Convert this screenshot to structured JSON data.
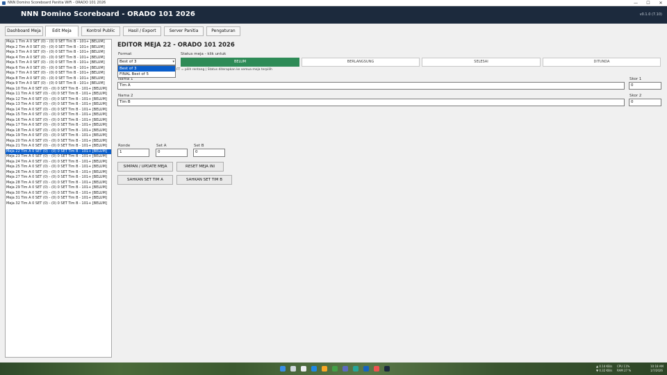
{
  "window": {
    "os_title": "NNN Domino Scoreboard Panitia WiFi - ORADO 101 2026",
    "minimize": "—",
    "maximize": "☐",
    "close": "✕"
  },
  "header": {
    "title": "NNN Domino Scoreboard - ORADO 101 2026",
    "version": "v0.1.0 (7.10)"
  },
  "tabs": [
    {
      "label": "Dashboard Meja"
    },
    {
      "label": "Edit Meja"
    },
    {
      "label": "Kontrol Public"
    },
    {
      "label": "Hasil / Export"
    },
    {
      "label": "Server Panitia"
    },
    {
      "label": "Pengaturan"
    }
  ],
  "meja_list": [
    "Meja 1   Tim A  0 SET  (0)  -  (0)  0 SET  Tim B  -  101+  [BELUM]",
    "Meja 2   Tim A  0 SET  (0)  -  (0)  0 SET  Tim B  -  101+  [BELUM]",
    "Meja 3   Tim A  0 SET  (0)  -  (0)  0 SET  Tim B  -  101+  [BELUM]",
    "Meja 4   Tim A  0 SET  (0)  -  (0)  0 SET  Tim B  -  101+  [BELUM]",
    "Meja 5   Tim A  0 SET  (0)  -  (0)  0 SET  Tim B  -  101+  [BELUM]",
    "Meja 6   Tim A  0 SET  (0)  -  (0)  0 SET  Tim B  -  101+  [BELUM]",
    "Meja 7   Tim A  0 SET  (0)  -  (0)  0 SET  Tim B  -  101+  [BELUM]",
    "Meja 8   Tim A  0 SET  (0)  -  (0)  0 SET  Tim B  -  101+  [BELUM]",
    "Meja 9   Tim A  0 SET  (0)  -  (0)  0 SET  Tim B  -  101+  [BELUM]",
    "Meja 10  Tim A  0 SET  (0)  -  (0)  0 SET  Tim B  -  101+  [BELUM]",
    "Meja 11  Tim A  0 SET  (0)  -  (0)  0 SET  Tim B  -  101+  [BELUM]",
    "Meja 12  Tim A  0 SET  (0)  -  (0)  0 SET  Tim B  -  101+  [BELUM]",
    "Meja 13  Tim A  0 SET  (0)  -  (0)  0 SET  Tim B  -  101+  [BELUM]",
    "Meja 14  Tim A  0 SET  (0)  -  (0)  0 SET  Tim B  -  101+  [BELUM]",
    "Meja 15  Tim A  0 SET  (0)  -  (0)  0 SET  Tim B  -  101+  [BELUM]",
    "Meja 16  Tim A  0 SET  (0)  -  (0)  0 SET  Tim B  -  101+  [BELUM]",
    "Meja 17  Tim A  0 SET  (0)  -  (0)  0 SET  Tim B  -  101+  [BELUM]",
    "Meja 18  Tim A  0 SET  (0)  -  (0)  0 SET  Tim B  -  101+  [BELUM]",
    "Meja 19  Tim A  0 SET  (0)  -  (0)  0 SET  Tim B  -  101+  [BELUM]",
    "Meja 20  Tim A  0 SET  (0)  -  (0)  0 SET  Tim B  -  101+  [BELUM]",
    "Meja 21  Tim A  0 SET  (0)  -  (0)  0 SET  Tim B  -  101+  [BELUM]",
    "Meja 22  Tim A  0 SET  (0)  -  (0)  0 SET  Tim B  -  101+  [BELUM]",
    "Meja 23  Tim A  0 SET  (0)  -  (0)  0 SET  Tim B  -  101+  [BELUM]",
    "Meja 24  Tim A  0 SET  (0)  -  (0)  0 SET  Tim B  -  101+  [BELUM]",
    "Meja 25  Tim A  0 SET  (0)  -  (0)  0 SET  Tim B  -  101+  [BELUM]",
    "Meja 26  Tim A  0 SET  (0)  -  (0)  0 SET  Tim B  -  101+  [BELUM]",
    "Meja 27  Tim A  0 SET  (0)  -  (0)  0 SET  Tim B  -  101+  [BELUM]",
    "Meja 28  Tim A  0 SET  (0)  -  (0)  0 SET  Tim B  -  101+  [BELUM]",
    "Meja 29  Tim A  0 SET  (0)  -  (0)  0 SET  Tim B  -  101+  [BELUM]",
    "Meja 30  Tim A  0 SET  (0)  -  (0)  0 SET  Tim B  -  101+  [BELUM]",
    "Meja 31  Tim A  0 SET  (0)  -  (0)  0 SET  Tim B  -  101+  [BELUM]",
    "Meja 32  Tim A  0 SET  (0)  -  (0)  0 SET  Tim B  -  101+  [BELUM]"
  ],
  "selected_meja": "Meja 22",
  "editor": {
    "title": "EDITOR MEJA 22 - ORADO 101 2026",
    "format_label": "Format",
    "format_value": "Best of 3",
    "format_options": [
      "Best of 3",
      "FINAL Best of 5"
    ],
    "status_label": "Status meja - klik untuk",
    "status_buttons": [
      "BELUM",
      "BERLANGSUNG",
      "SELESAI",
      "DITUNDA"
    ],
    "status_active": "BELUM",
    "hint": "FT = pilih rentang | Status diterapkan ke semua meja terpilih",
    "nama1_label": "Nama 1",
    "nama1_value": "Tim A",
    "skor1_label": "Skor 1",
    "skor1_value": "0",
    "nama2_label": "Nama 2",
    "nama2_value": "Tim B",
    "skor2_label": "Skor 2",
    "skor2_value": "0",
    "ronde_label": "Ronde",
    "ronde_value": "1",
    "seta_label": "Set A",
    "seta_value": "0",
    "setb_label": "Set B",
    "setb_value": "0",
    "btn_simpan": "SIMPAN / UPDATE MEJA",
    "btn_reset": "RESET MEJA INI",
    "btn_sahkan_a": "SAHKAN SET TIM A",
    "btn_sahkan_b": "SAHKAN SET TIM B"
  },
  "taskbar": {
    "net1": "▲ 0.14 KB/s",
    "net2": "▼ 0.32 KB/s",
    "cpu": "CPU  11%",
    "ram": "RAM  27 %",
    "time": "10:18 AM",
    "date": "1/7/2026"
  },
  "colors": {
    "header_bg": "#1c2a3d",
    "status_active": "#2e8b57",
    "selection": "#0a5ecb"
  }
}
